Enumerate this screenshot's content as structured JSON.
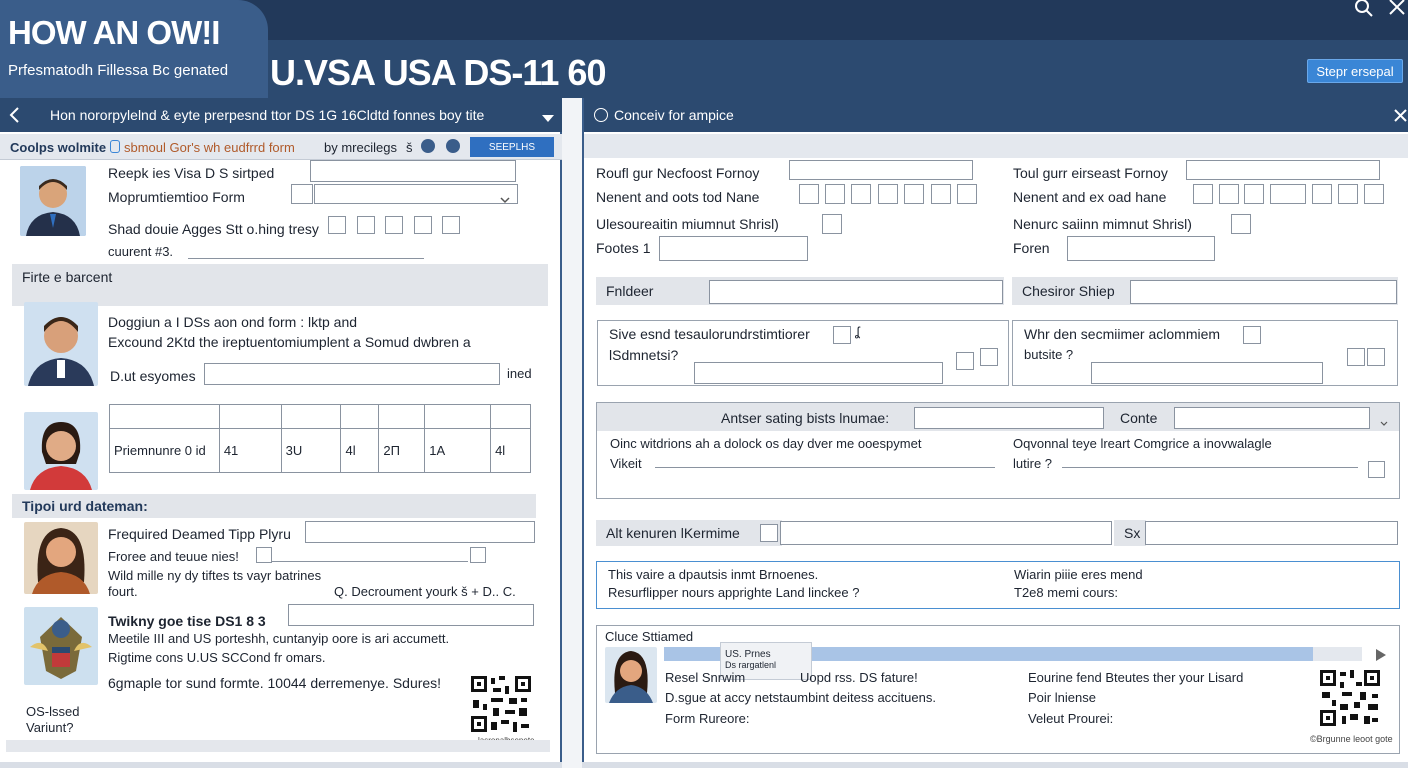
{
  "header": {
    "brand": "HOW AN OW!I",
    "brand_sub": "Prfesmatodh Fillessa Bc genated",
    "title": "U.VSA USA DS-11 60",
    "action_button": "Stepr ersepal"
  },
  "left_panel": {
    "header_text": "Hon nororpylelnd & eyte prerpesnd ttor DS 1G 16Cldtd fonnes boy tite",
    "toolbar_label": "Coolps wolmite",
    "toolbar_link": "sbmoul Gor's wh eudfrrd form",
    "toolbar_by": "by mrecilegs",
    "toolbar_sep": "š",
    "toolbar_button": "SEEPLHS",
    "block1": {
      "line1": "Reepk ies Visa D S sirtped",
      "line2": "Moprumtiemtioo Form",
      "line3": "Shad douie Agges Stt o.hing tresy",
      "line4": "cuurent #3."
    },
    "section1": "Firte e barcent",
    "block2": {
      "line1": "Doggiun a I DSs aon ond form : lktp and",
      "line2": "Excound 2Ktd the ireptuentomiumplent a Somud dwbren a",
      "line3": "D.ut esyomes",
      "suffix": "ined"
    },
    "table": {
      "row_label": "Priemnunre 0 id",
      "cells": [
        "41",
        "3U",
        "4l",
        "2Π",
        "1A",
        "4l"
      ]
    },
    "section2": "Tipoi urd dateman:",
    "block3": {
      "line1": "Frequired Deamed Tipp Plyru",
      "line2": "Froree and teuue nies!",
      "line3": "Wild mille ny dy tiftes ts vayr batrines",
      "line4": "fourt.",
      "line5": "Q.  Decroument yourk š + D.. C."
    },
    "block4": {
      "line1": "Twikny goe tise DS1 8 3",
      "line2": "Meetile III and US porteshh, cuntanyip oore is ari accumett.",
      "line3": "Rigtime cons U.US SCCond fr omars.",
      "line4": "6gmaple tor sund formte. 10044 derremenye. Sdures!",
      "foot1": "OS-lssed",
      "foot2": "Variunt?",
      "qr_caption": "lasronalbsepote"
    }
  },
  "right_panel": {
    "header_text": "Conceiv for ampice",
    "row1_left": "Roufl gur Necfoost Fornoy",
    "row1_right": "Toul gurr eirseast Fornoy",
    "row2_left": "Nenent and oots tod Nane",
    "row2_right": "Nenent  and ex oad hane",
    "row3_left": "Ulesoureaitin miumnut Shrisl)",
    "row3_right": "Nenurc saiinn mimnut Shrisl)",
    "row4_left": "Footes 1",
    "row4_right": "Foren",
    "section_left": "Fnldeer",
    "section_right": "Chesiror Shiep",
    "q1_line1": "Sive esnd tesaulorundrstimtiorer",
    "q1_line2": "lSdmnetsi?",
    "q1_mark": "ʆ",
    "q2_line1": "Whr den  secmiimer aclommiem",
    "q2_line2": "butsite ?",
    "bar_label": "Antser  sating bists lnumae:",
    "bar_label2": "Conte",
    "q3_left_1": "Oinc witdrions ah a dolock os day dver me ooespymet",
    "q3_left_2": "Vikeit",
    "q3_right_1": "Oqvonnal teye lreart Comgrice a inovwalagle",
    "q3_right_2": "lutire ?",
    "row5_left": "Alt kenuren lKermime",
    "row5_right": "Sx",
    "info_left_1": "This vaire a dpautsis inmt Brnoenes.",
    "info_left_2": "Resurflipper nours apprighte Land linckee ?",
    "info_right_1": "Wiarin piiie eres mend",
    "info_right_2": "T2e8 memi cours:",
    "card_title": "Cluce Sttiamed",
    "progress_label": "US. Prnes",
    "progress_sub": "Ds rargatlenl",
    "progress_value": 0.93,
    "card_l1": "Resel Snrwim",
    "card_l1b": "Uopd rss. DS fature!",
    "card_l2": "D.sgue at accy netstaumbint deitess accituens.",
    "card_l3": "Form Rureore:",
    "card_r1": "Eourine fend Bteutes ther your Lisard",
    "card_r2": "Poir lniense",
    "card_r3": "Veleut Prourei:",
    "qr_caption": "©Brgunne leoot gote"
  },
  "colors": {
    "navy": "#2c4a70",
    "accent_blue": "#3a86d6",
    "progress": "#a9c4e6"
  }
}
